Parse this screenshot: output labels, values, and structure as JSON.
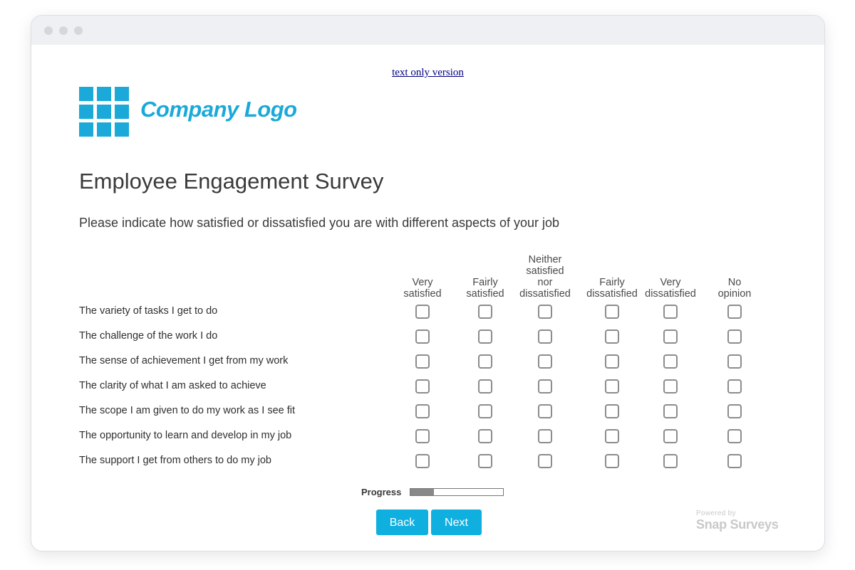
{
  "links": {
    "text_only": "text only version"
  },
  "logo": {
    "text": "Company Logo",
    "color": "#1aa9d8"
  },
  "survey": {
    "title": "Employee Engagement Survey",
    "question": "Please indicate how satisfied or dissatisfied you are with different aspects of your job",
    "columns": [
      {
        "lines": [
          "Very",
          "satisfied"
        ]
      },
      {
        "lines": [
          "Fairly",
          "satisfied"
        ]
      },
      {
        "lines": [
          "Neither",
          "satisfied",
          "nor",
          "dissatisfied"
        ]
      },
      {
        "lines": [
          "Fairly",
          "dissatisfied"
        ]
      },
      {
        "lines": [
          "Very",
          "dissatisfied"
        ]
      },
      {
        "lines": [
          "No",
          "opinion"
        ]
      }
    ],
    "rows": [
      "The variety of tasks I get to do",
      "The challenge of the work I do",
      "The sense of achievement I get from my work",
      "The clarity of what I am asked to achieve",
      "The scope I am given to do my work as I see fit",
      "The opportunity to learn and develop in my job",
      "The support I get from others to do my job"
    ]
  },
  "progress": {
    "label": "Progress",
    "value": 0.25
  },
  "buttons": {
    "back": "Back",
    "next": "Next",
    "color": "#0fb0e0"
  },
  "powered_by": {
    "small": "Powered by",
    "brand": "Snap Surveys"
  }
}
